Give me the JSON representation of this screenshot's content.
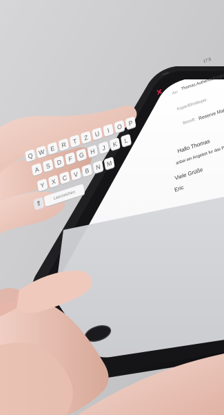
{
  "phone": {
    "status_left": "•••• ",
    "status_time": "17:5",
    "compose": {
      "close_icon": "close-icon",
      "to_label": "An:",
      "to_value": "Thomas.AuthenticProgramme",
      "cc_line": "Kopie/Blindkopie:",
      "subject_label": "Betreff:",
      "subject_value": "Reserve Mail",
      "body_lines": [
        "Hallo Thomas",
        "anbei ein Angebot fur das Programm",
        "Viele Grüße",
        "Eric"
      ]
    },
    "keyboard": {
      "row1": [
        "Q",
        "W",
        "E",
        "R",
        "T",
        "Z",
        "U",
        "I",
        "O",
        "P"
      ],
      "row2": [
        "A",
        "S",
        "D",
        "F",
        "G",
        "H",
        "J",
        "K",
        "L"
      ],
      "row3": [
        "Y",
        "X",
        "C",
        "V",
        "B",
        "N",
        "M"
      ],
      "space_label": "Leerzeichen",
      "shift_icon": "shift-icon",
      "colors": {
        "key": "#f7f7f8",
        "accent_close": "#e0264a"
      }
    }
  }
}
